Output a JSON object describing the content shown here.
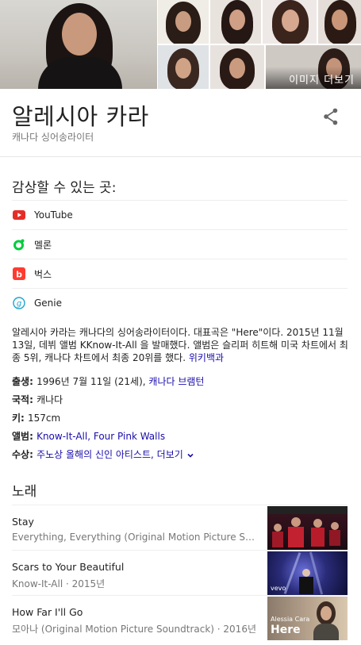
{
  "images": {
    "more_label": "이미지 더보기",
    "alt_main": "",
    "thumbs": [
      "",
      "",
      "",
      "",
      "",
      "",
      ""
    ]
  },
  "header": {
    "title": "알레시아 카라",
    "subtitle": "캐나다 싱어송라이터"
  },
  "watch": {
    "title": "감상할 수 있는 곳:",
    "providers": [
      {
        "name": "YouTube",
        "icon": "youtube-icon",
        "color": "#e52d27"
      },
      {
        "name": "멜론",
        "icon": "melon-icon",
        "color": "#00cd3c"
      },
      {
        "name": "벅스",
        "icon": "bugs-icon",
        "color": "#ff3b30"
      },
      {
        "name": "Genie",
        "icon": "genie-icon",
        "color": "#1ba4cf"
      }
    ]
  },
  "description": {
    "text": "알레시아 카라는 캐나다의 싱어송라이터이다. 대표곡은 \"Here\"이다. 2015년 11월 13일, 데뷔 앨범 KKnow-It-All 을 발매했다. 앨범은 슬리퍼 히트해 미국 차트에서 최종 5위, 캐나다 차트에서 최종 20위를 했다.",
    "source": "위키백과"
  },
  "facts": {
    "born_key": "출생",
    "born_value": "1996년 7월 11일 (21세),",
    "born_place": "캐나다 브램턴",
    "nationality_key": "국적",
    "nationality_value": "캐나다",
    "height_key": "키",
    "height_value": "157cm",
    "albums_key": "앨범",
    "albums_value": "Know-It-All, Four Pink Walls",
    "awards_key": "수상",
    "awards_value": "주노상 올해의 신인 아티스트,",
    "awards_more": "더보기"
  },
  "songs": {
    "title": "노래",
    "items": [
      {
        "title": "Stay",
        "album": "Everything, Everything (Original Motion Picture Soundtrack)",
        "thumb_label": ""
      },
      {
        "title": "Scars to Your Beautiful",
        "album": "Know-It-All · 2015년",
        "thumb_label": "vevo"
      },
      {
        "title": "How Far I'll Go",
        "album": "모아나 (Original Motion Picture Soundtrack) · 2016년",
        "thumb_label": "Alessia Cara",
        "thumb_big": "Here"
      }
    ]
  },
  "colors": {
    "link": "#1a0dab",
    "muted": "#777777",
    "divider": "#eeeeee"
  }
}
